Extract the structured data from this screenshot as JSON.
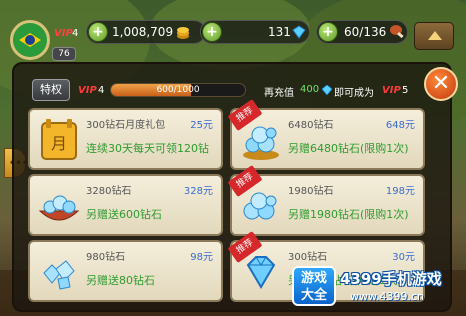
{
  "hud": {
    "vip_label": "VIP",
    "vip_level": "4",
    "player_level": "76",
    "gold": "1,008,709",
    "gems": "131",
    "stamina": "60/136"
  },
  "panel": {
    "tab_label": "特权",
    "vip_label": "VIP",
    "current_vip": "4",
    "progress_text": "600/1000",
    "progress_fraction": 0.6,
    "recharge_prefix": "再充值",
    "recharge_amount": "400",
    "recharge_suffix": "即可成为",
    "next_vip": "5",
    "close_glyph": "✕"
  },
  "ribbon_label": "推荐",
  "cards": [
    {
      "title": "300钻石月度礼包",
      "price": "25元",
      "desc": "连续30天每天可领120钻",
      "icon": "monthly-card-icon",
      "recommended": false
    },
    {
      "title": "6480钻石",
      "price": "648元",
      "desc": "另赠6480钻石(限购1次)",
      "icon": "gem-pile-icon",
      "recommended": true
    },
    {
      "title": "3280钻石",
      "price": "328元",
      "desc": "另赠送600钻石",
      "icon": "gem-bowl-icon",
      "recommended": false
    },
    {
      "title": "1980钻石",
      "price": "198元",
      "desc": "另赠1980钻石(限购1次)",
      "icon": "gem-pile-icon",
      "recommended": true
    },
    {
      "title": "980钻石",
      "price": "98元",
      "desc": "另赠送80钻石",
      "icon": "gem-cluster-icon",
      "recommended": false
    },
    {
      "title": "300钻石",
      "price": "30元",
      "desc": "另赠300钻石(限购1次)",
      "icon": "gem-single-icon",
      "recommended": true
    }
  ],
  "watermark": {
    "logo_line1": "游戏",
    "logo_line2": "大全",
    "title": "4399手机游戏",
    "url": "www.4399.cn"
  },
  "colors": {
    "vip_red": "#ff3a3a",
    "price_blue": "#3a6bd0",
    "desc_green": "#2f9b2f",
    "progress_orange": "#e0862e",
    "ribbon_red": "#d6272a"
  }
}
